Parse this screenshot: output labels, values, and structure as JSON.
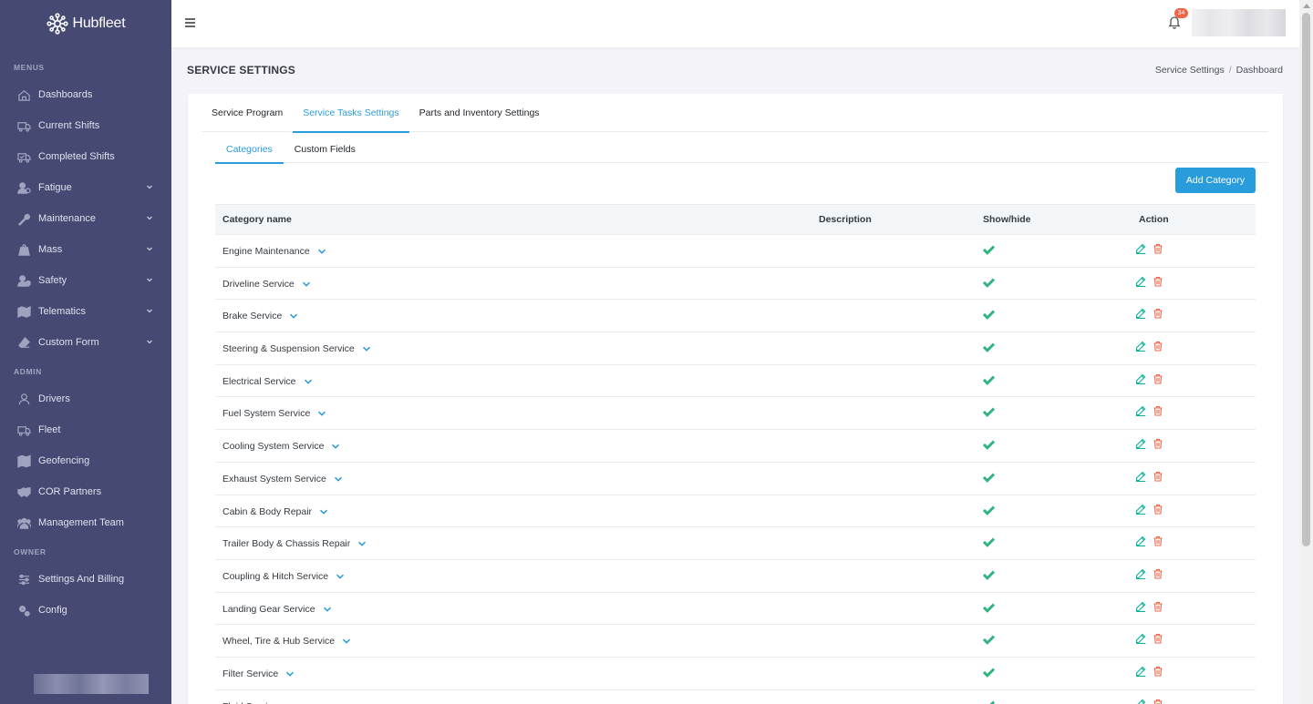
{
  "brand": {
    "name": "Hubfleet"
  },
  "sidebar": {
    "sections": [
      {
        "title": "MENUS",
        "items": [
          {
            "label": "Dashboards",
            "icon": "home-icon",
            "expandable": false
          },
          {
            "label": "Current Shifts",
            "icon": "truck-icon",
            "expandable": false
          },
          {
            "label": "Completed Shifts",
            "icon": "truck-check-icon",
            "expandable": false
          },
          {
            "label": "Fatigue",
            "icon": "user-clock-icon",
            "expandable": true
          },
          {
            "label": "Maintenance",
            "icon": "wrench-icon",
            "expandable": true
          },
          {
            "label": "Mass",
            "icon": "weight-icon",
            "expandable": true
          },
          {
            "label": "Safety",
            "icon": "user-shield-icon",
            "expandable": true
          },
          {
            "label": "Telematics",
            "icon": "map-pin-icon",
            "expandable": true
          },
          {
            "label": "Custom Form",
            "icon": "eraser-icon",
            "expandable": true
          }
        ]
      },
      {
        "title": "ADMIN",
        "items": [
          {
            "label": "Drivers",
            "icon": "user-icon",
            "expandable": false
          },
          {
            "label": "Fleet",
            "icon": "truck-icon",
            "expandable": false
          },
          {
            "label": "Geofencing",
            "icon": "map-icon",
            "expandable": false
          },
          {
            "label": "COR Partners",
            "icon": "handshake-icon",
            "expandable": false
          },
          {
            "label": "Management Team",
            "icon": "users-icon",
            "expandable": false
          }
        ]
      },
      {
        "title": "OWNER",
        "items": [
          {
            "label": "Settings And Billing",
            "icon": "sliders-icon",
            "expandable": false
          },
          {
            "label": "Config",
            "icon": "gears-icon",
            "expandable": false
          }
        ]
      }
    ]
  },
  "topbar": {
    "notifications_count": "34"
  },
  "page": {
    "title": "SERVICE SETTINGS",
    "breadcrumb": [
      "Service Settings",
      "Dashboard"
    ],
    "breadcrumb_separator": "/"
  },
  "tabs": [
    {
      "label": "Service Program",
      "active": false
    },
    {
      "label": "Service Tasks Settings",
      "active": true
    },
    {
      "label": "Parts and Inventory Settings",
      "active": false
    }
  ],
  "subtabs": [
    {
      "label": "Categories",
      "active": true
    },
    {
      "label": "Custom Fields",
      "active": false
    }
  ],
  "add_button": {
    "label": "Add Category"
  },
  "table": {
    "columns": [
      "Category name",
      "Description",
      "Show/hide",
      "Action"
    ],
    "rows": [
      {
        "name": "Engine Maintenance",
        "description": "",
        "visible": true
      },
      {
        "name": "Driveline Service",
        "description": "",
        "visible": true
      },
      {
        "name": "Brake Service",
        "description": "",
        "visible": true
      },
      {
        "name": "Steering & Suspension Service",
        "description": "",
        "visible": true
      },
      {
        "name": "Electrical Service",
        "description": "",
        "visible": true
      },
      {
        "name": "Fuel System Service",
        "description": "",
        "visible": true
      },
      {
        "name": "Cooling System Service",
        "description": "",
        "visible": true
      },
      {
        "name": "Exhaust System Service",
        "description": "",
        "visible": true
      },
      {
        "name": "Cabin & Body Repair",
        "description": "",
        "visible": true
      },
      {
        "name": "Trailer Body & Chassis Repair",
        "description": "",
        "visible": true
      },
      {
        "name": "Coupling & Hitch Service",
        "description": "",
        "visible": true
      },
      {
        "name": "Landing Gear Service",
        "description": "",
        "visible": true
      },
      {
        "name": "Wheel, Tire & Hub Service",
        "description": "",
        "visible": true
      },
      {
        "name": "Filter Service",
        "description": "",
        "visible": true
      },
      {
        "name": "Fluid Service",
        "description": "",
        "visible": true
      }
    ]
  },
  "colors": {
    "sidebar_bg": "#464a73",
    "accent": "#299cdb",
    "success": "#2fb380",
    "danger": "#f06548",
    "edit": "#0ab39c"
  }
}
